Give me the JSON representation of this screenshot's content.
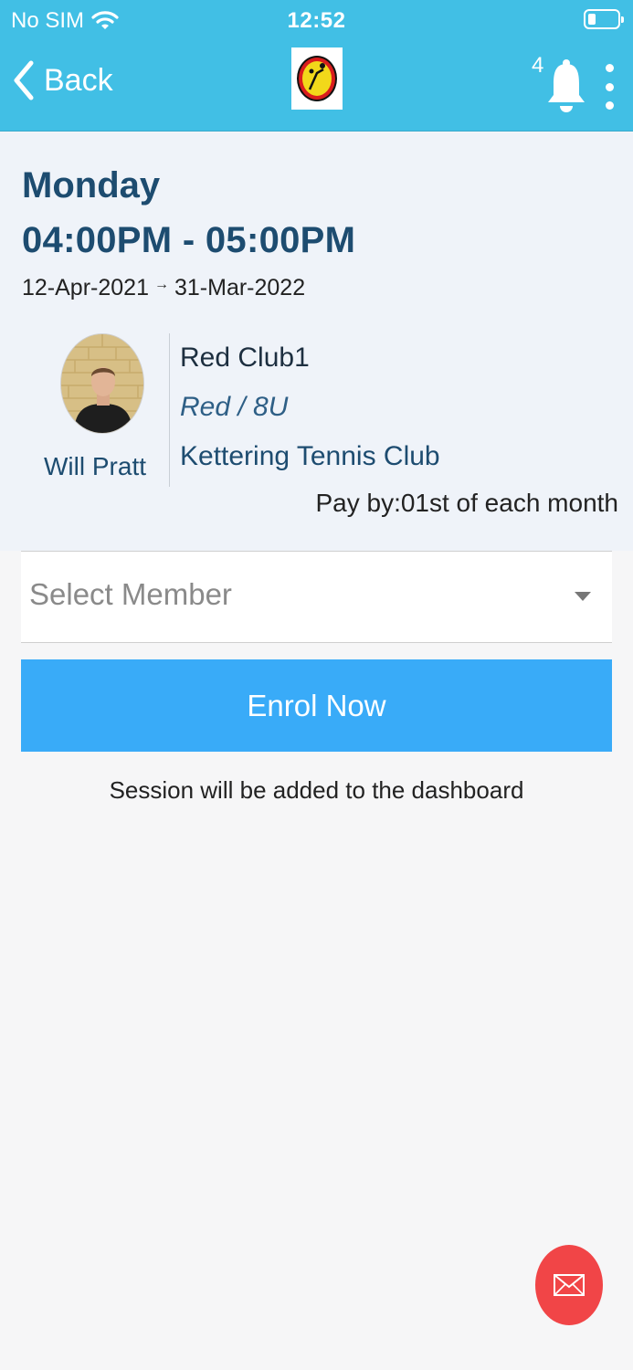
{
  "status_bar": {
    "carrier": "No SIM",
    "time": "12:52"
  },
  "header": {
    "back_label": "Back",
    "notification_count": "4",
    "logo_text": "Kettering Tennis Club"
  },
  "session": {
    "day": "Monday",
    "time_range": "04:00PM - 05:00PM",
    "start_date": "12-Apr-2021",
    "end_date": "31-Mar-2022",
    "coach_name": "Will Pratt",
    "class_name": "Red Club1",
    "level": "Red / 8U",
    "venue": "Kettering Tennis Club",
    "pay_by": "Pay by:01st of each month"
  },
  "form": {
    "member_placeholder": "Select Member",
    "enrol_label": "Enrol Now",
    "note": "Session will be added to the dashboard"
  },
  "colors": {
    "header": "#41bfe5",
    "title_text": "#1d4c70",
    "enrol_button": "#39abf8",
    "fab": "#f14547"
  },
  "icons": [
    "wifi-icon",
    "battery-icon",
    "chevron-left-icon",
    "bell-icon",
    "more-vertical-icon",
    "chevron-down-icon",
    "mail-icon"
  ]
}
